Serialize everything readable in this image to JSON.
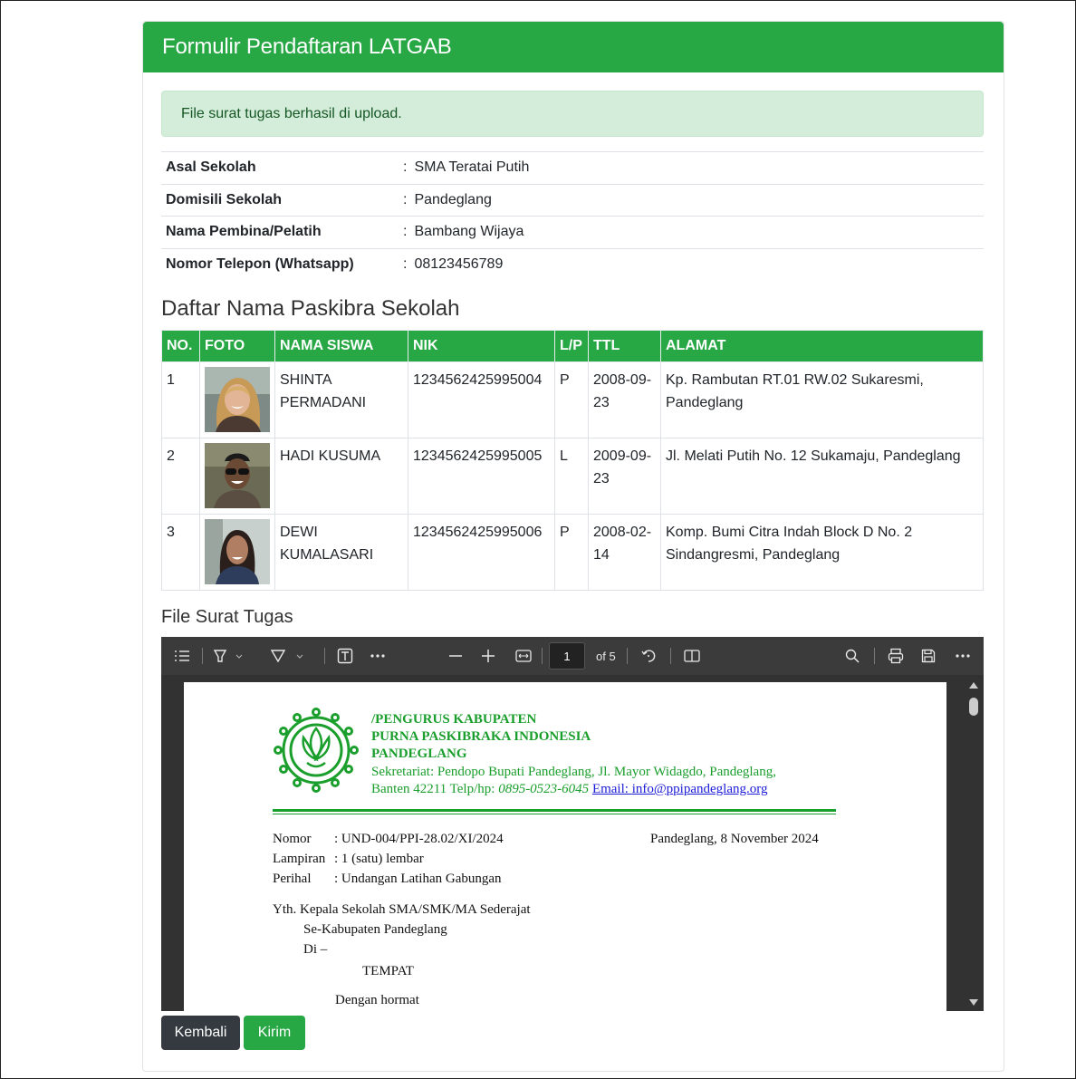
{
  "header": {
    "title": "Formulir Pendaftaran LATGAB"
  },
  "alert": {
    "message": "File surat tugas berhasil di upload."
  },
  "info": [
    {
      "label": "Asal Sekolah",
      "value": "SMA Teratai Putih"
    },
    {
      "label": "Domisili Sekolah",
      "value": "Pandeglang"
    },
    {
      "label": "Nama Pembina/Pelatih",
      "value": "Bambang Wijaya"
    },
    {
      "label": "Nomor Telepon (Whatsapp)",
      "value": "08123456789"
    }
  ],
  "colon": ":",
  "students_section": {
    "title": "Daftar Nama Paskibra Sekolah",
    "columns": [
      "NO.",
      "FOTO",
      "NAMA SISWA",
      "NIK",
      "L/P",
      "TTL",
      "ALAMAT"
    ],
    "rows": [
      {
        "no": "1",
        "name": "SHINTA PERMADANI",
        "nik": "1234562425995004",
        "lp": "P",
        "ttl": "2008-09-23",
        "address": "Kp. Rambutan RT.01 RW.02 Sukaresmi, Pandeglang"
      },
      {
        "no": "2",
        "name": "HADI KUSUMA",
        "nik": "1234562425995005",
        "lp": "L",
        "ttl": "2009-09-23",
        "address": "Jl. Melati Putih No. 12 Sukamaju, Pandeglang"
      },
      {
        "no": "3",
        "name": "DEWI KUMALASARI",
        "nik": "1234562425995006",
        "lp": "P",
        "ttl": "2008-02-14",
        "address": "Komp. Bumi Citra Indah Block D No. 2 Sindangresmi, Pandeglang"
      }
    ]
  },
  "file_section": {
    "title": "File Surat Tugas"
  },
  "pdf_viewer": {
    "current_page": "1",
    "page_count_label": "of 5",
    "icons": [
      "contents-icon",
      "highlight-icon",
      "draw-icon",
      "text-icon",
      "more-icon",
      "zoom-out-icon",
      "zoom-in-icon",
      "fit-page-icon",
      "rotate-icon",
      "two-page-icon",
      "search-icon",
      "print-icon",
      "save-icon",
      "more-menu-icon"
    ],
    "letter": {
      "org_line1": "/PENGURUS KABUPATEN",
      "org_line2": "PURNA PASKIBRAKA INDONESIA",
      "org_line3": "PANDEGLANG",
      "address_line1": "Sekretariat: Pendopo Bupati Pandeglang, Jl. Mayor Widagdo, Pandeglang,",
      "address_line2": "Banten 42211 Telp/hp: ",
      "phone": "0895-0523-6045",
      "email_label": "Email: ",
      "email": "info@ppipandeglang.org",
      "nomor_label": "Nomor",
      "nomor_value": ": UND-004/PPI-28.02/XI/2024",
      "place_date": "Pandeglang, 8 November 2024",
      "lampiran_label": "Lampiran",
      "lampiran_value": ": 1 (satu) lembar",
      "perihal_label": "Perihal",
      "perihal_value": ": Undangan Latihan Gabungan",
      "yth": "Yth. Kepala Sekolah SMA/SMK/MA Sederajat",
      "se_kab": "Se-Kabupaten Pandeglang",
      "di": "Di –",
      "tempat": "TEMPAT",
      "salam": "Dengan hormat"
    }
  },
  "buttons": {
    "back": "Kembali",
    "submit": "Kirim"
  },
  "colors": {
    "primary": "#28a745",
    "dark": "#343a40",
    "alert_bg": "#d4edda"
  }
}
